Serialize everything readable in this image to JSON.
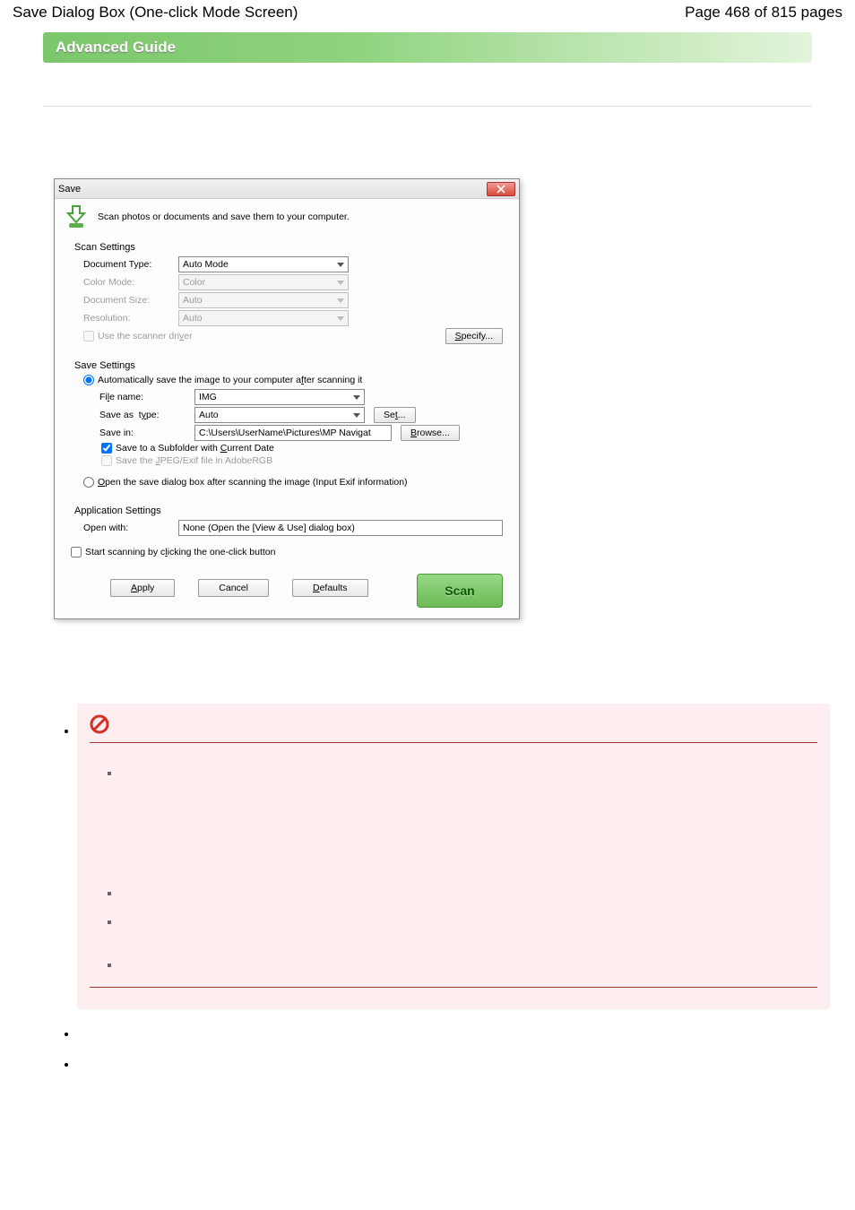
{
  "page": {
    "title_left": "Save Dialog Box (One-click Mode Screen)",
    "title_right": "Page 468 of 815 pages"
  },
  "guide_bar": "Advanced Guide",
  "dialog": {
    "window_title": "Save",
    "subtitle": "Scan photos or documents and save them to your computer.",
    "scan_settings": {
      "heading": "Scan Settings",
      "document_type_label": "Document Type:",
      "document_type_value": "Auto Mode",
      "color_mode_label": "Color Mode:",
      "color_mode_value": "Color",
      "document_size_label": "Document Size:",
      "document_size_value": "Auto",
      "resolution_label": "Resolution:",
      "resolution_value": "Auto",
      "use_scanner_driver": "Use the scanner driver",
      "specify_btn": "Specify..."
    },
    "save_settings": {
      "heading": "Save Settings",
      "auto_save_radio": "Automatically save the image to your computer after scanning it",
      "file_name_label": "File name:",
      "file_name_value": "IMG",
      "save_as_type_label": "Save as type:",
      "save_as_type_value": "Auto",
      "set_btn": "Set...",
      "save_in_label": "Save in:",
      "save_in_value": "C:\\Users\\UserName\\Pictures\\MP Navigat",
      "browse_btn": "Browse...",
      "subfolder_cb": "Save to a Subfolder with Current Date",
      "adobergb_cb": "Save the JPEG/Exif file in AdobeRGB",
      "open_save_radio": "Open the save dialog box after scanning the image (Input Exif information)"
    },
    "app_settings": {
      "heading": "Application Settings",
      "open_with_label": "Open with:",
      "open_with_value": "None (Open the [View & Use] dialog box)"
    },
    "start_cb": "Start scanning by clicking the one-click button",
    "buttons": {
      "apply": "Apply",
      "cancel": "Cancel",
      "defaults": "Defaults",
      "scan": "Scan"
    }
  }
}
